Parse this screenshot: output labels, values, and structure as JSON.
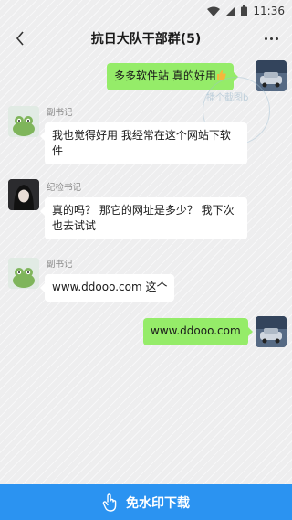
{
  "status_bar": {
    "time": "11:36"
  },
  "header": {
    "title": "抗日大队干部群(5)"
  },
  "messages": [
    {
      "direction": "out",
      "text": "多多软件站 真的好用"
    },
    {
      "direction": "in",
      "sender": "副书记",
      "text": "我也觉得好用 我经常在这个网站下软件"
    },
    {
      "direction": "in",
      "sender": "纪检书记",
      "text": "真的吗？ 那它的网址是多少？ 我下次也去试试"
    },
    {
      "direction": "in",
      "sender": "副书记",
      "text": "www.ddooo.com 这个"
    },
    {
      "direction": "out",
      "text": "www.ddooo.com"
    }
  ],
  "watermark": {
    "text": "播个截图b"
  },
  "download": {
    "label": "免水印下载"
  },
  "colors": {
    "outgoing_bubble": "#95ec69",
    "incoming_bubble": "#ffffff",
    "download_bar": "#2b93f1"
  }
}
